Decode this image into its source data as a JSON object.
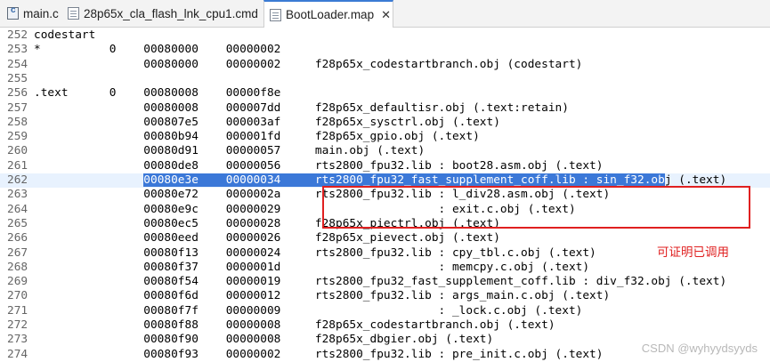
{
  "tabs": [
    {
      "label": "main.c",
      "icon": "c-file-icon",
      "active": false
    },
    {
      "label": "28p65x_cla_flash_lnk_cpu1.cmd",
      "icon": "document-icon",
      "active": false
    },
    {
      "label": "BootLoader.map",
      "icon": "document-icon",
      "active": true,
      "close": "✕"
    }
  ],
  "editor": {
    "lines": [
      {
        "num": "252",
        "text": "codestart"
      },
      {
        "num": "253",
        "text": "*          0    00080000    00000002"
      },
      {
        "num": "254",
        "text": "                00080000    00000002     f28p65x_codestartbranch.obj (codestart)"
      },
      {
        "num": "255",
        "text": ""
      },
      {
        "num": "256",
        "text": ".text      0    00080008    00000f8e"
      },
      {
        "num": "257",
        "text": "                00080008    000007dd     f28p65x_defaultisr.obj (.text:retain)"
      },
      {
        "num": "258",
        "text": "                000807e5    000003af     f28p65x_sysctrl.obj (.text)"
      },
      {
        "num": "259",
        "text": "                00080b94    000001fd     f28p65x_gpio.obj (.text)"
      },
      {
        "num": "260",
        "text": "                00080d91    00000057     main.obj (.text)"
      },
      {
        "num": "261",
        "text": "                00080de8    00000056     rts2800_fpu32.lib : boot28.asm.obj (.text)"
      },
      {
        "num": "262",
        "pre": "                ",
        "sel": "00080e3e    00000034     rts2800_fpu32_fast_supplement_coff.lib : sin_f32.ob",
        "post": "j (.text)",
        "current": true
      },
      {
        "num": "263",
        "text": "                00080e72    0000002a     rts2800_fpu32.lib : l_div28.asm.obj (.text)"
      },
      {
        "num": "264",
        "text": "                00080e9c    00000029                       : exit.c.obj (.text)"
      },
      {
        "num": "265",
        "text": "                00080ec5    00000028     f28p65x_piectrl.obj (.text)"
      },
      {
        "num": "266",
        "text": "                00080eed    00000026     f28p65x_pievect.obj (.text)"
      },
      {
        "num": "267",
        "text": "                00080f13    00000024     rts2800_fpu32.lib : cpy_tbl.c.obj (.text)"
      },
      {
        "num": "268",
        "text": "                00080f37    0000001d                       : memcpy.c.obj (.text)"
      },
      {
        "num": "269",
        "text": "                00080f54    00000019     rts2800_fpu32_fast_supplement_coff.lib : div_f32.obj (.text)"
      },
      {
        "num": "270",
        "text": "                00080f6d    00000012     rts2800_fpu32.lib : args_main.c.obj (.text)"
      },
      {
        "num": "271",
        "text": "                00080f7f    00000009                       : _lock.c.obj (.text)"
      },
      {
        "num": "272",
        "text": "                00080f88    00000008     f28p65x_codestartbranch.obj (.text)"
      },
      {
        "num": "273",
        "text": "                00080f90    00000008     f28p65x_dbgier.obj (.text)"
      },
      {
        "num": "274",
        "text": "                00080f93    00000002     rts2800_fpu32.lib : pre_init.c.obj (.text)"
      }
    ]
  },
  "annotation": {
    "note": "可证明已调用",
    "color": "#e02020"
  },
  "watermark": "CSDN @wyhyydsyyds"
}
